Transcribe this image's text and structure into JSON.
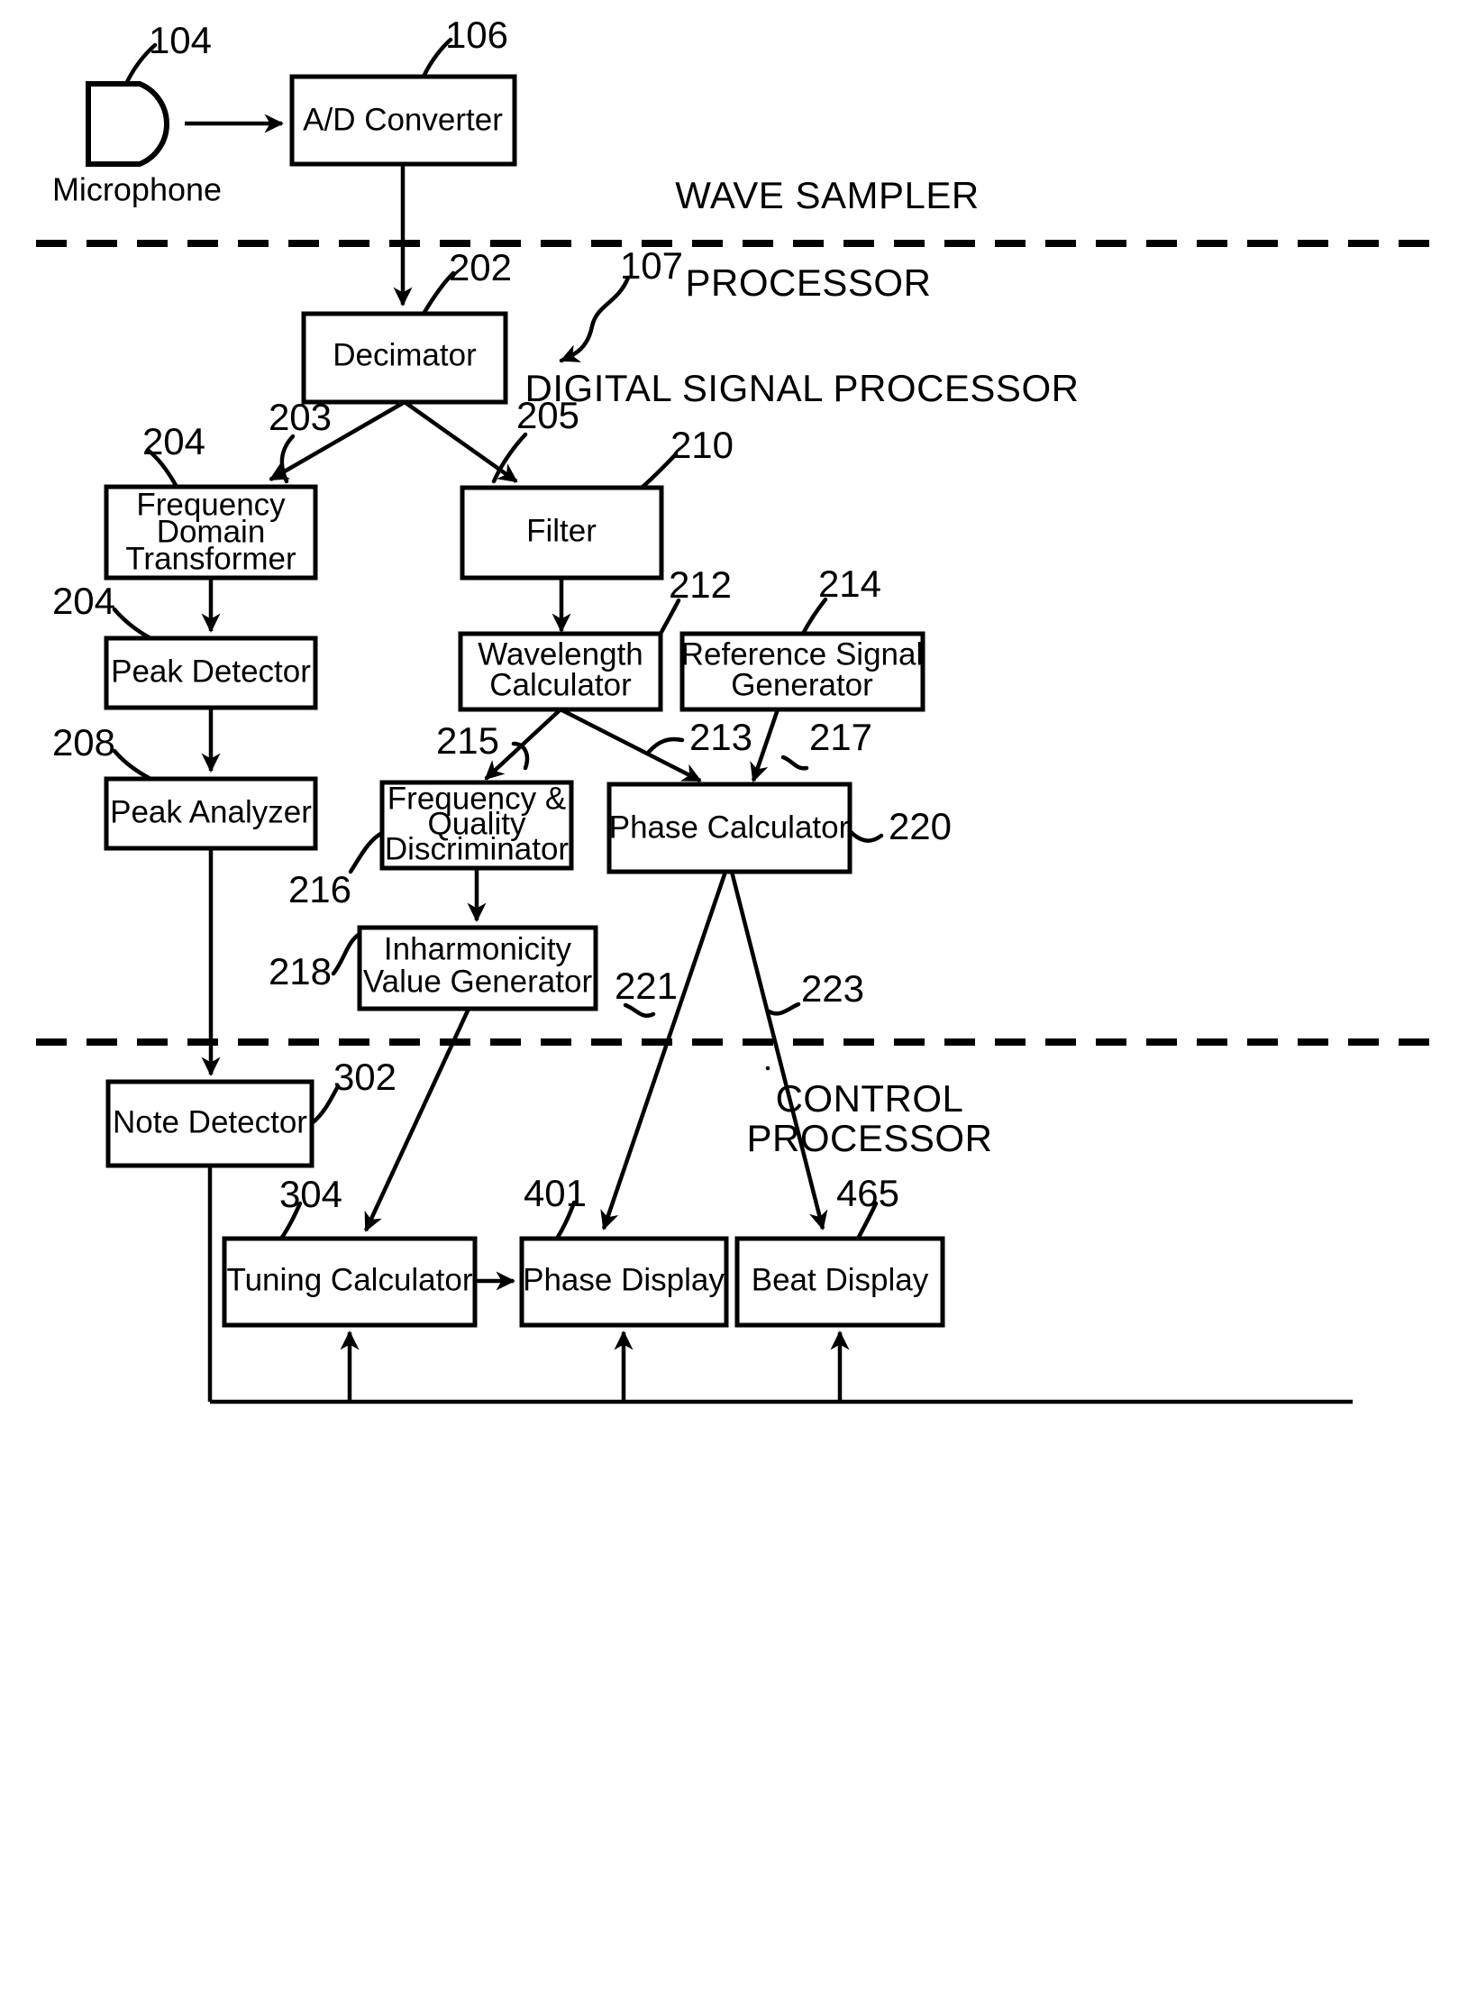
{
  "figure": {
    "type": "patent-block-diagram",
    "title": "Piano tuner signal processing block diagram"
  },
  "blocks": [
    {
      "id": "microphone",
      "label": "Microphone",
      "ref": "104",
      "shape": "d-shape"
    },
    {
      "id": "ad_converter",
      "label": "A/D Converter",
      "ref": "106",
      "shape": "rect"
    },
    {
      "id": "decimator",
      "label": "Decimator",
      "ref": "202",
      "shape": "rect"
    },
    {
      "id": "freq_domain_transformer",
      "label": "Frequency\nDomain\nTransformer",
      "ref": "204",
      "shape": "rect"
    },
    {
      "id": "peak_detector",
      "label": "Peak Detector",
      "ref": "204",
      "shape": "rect"
    },
    {
      "id": "peak_analyzer",
      "label": "Peak Analyzer",
      "ref": "208",
      "shape": "rect"
    },
    {
      "id": "filter",
      "label": "Filter",
      "ref": "210",
      "shape": "rect"
    },
    {
      "id": "wavelength_calculator",
      "label": "Wavelength\nCalculator",
      "ref": "212",
      "shape": "rect"
    },
    {
      "id": "reference_signal_generator",
      "label": "Reference Signal\nGenerator",
      "ref": "214",
      "shape": "rect"
    },
    {
      "id": "freq_quality_discriminator",
      "label": "Frequency &\nQuality\nDiscriminator",
      "ref": "216",
      "shape": "rect"
    },
    {
      "id": "phase_calculator",
      "label": "Phase Calculator",
      "ref": "220",
      "shape": "rect"
    },
    {
      "id": "inharmonicity_value_generator",
      "label": "Inharmonicity\nValue Generator",
      "ref": "218",
      "shape": "rect"
    },
    {
      "id": "note_detector",
      "label": "Note Detector",
      "ref": "302",
      "shape": "rect"
    },
    {
      "id": "tuning_calculator",
      "label": "Tuning Calculator",
      "ref": "304",
      "shape": "rect"
    },
    {
      "id": "phase_display",
      "label": "Phase Display",
      "ref": "401",
      "shape": "rect"
    },
    {
      "id": "beat_display",
      "label": "Beat Display",
      "ref": "465",
      "shape": "rect"
    }
  ],
  "block_labels": {
    "microphone": "Microphone",
    "ad_converter": "A/D Converter",
    "decimator": "Decimator",
    "fdt_line1": "Frequency",
    "fdt_line2": "Domain",
    "fdt_line3": "Transformer",
    "peak_detector": "Peak Detector",
    "peak_analyzer": "Peak Analyzer",
    "filter": "Filter",
    "wavelength_line1": "Wavelength",
    "wavelength_line2": "Calculator",
    "refsig_line1": "Reference Signal",
    "refsig_line2": "Generator",
    "fqd_line1": "Frequency &",
    "fqd_line2": "Quality",
    "fqd_line3": "Discriminator",
    "phase_calculator": "Phase Calculator",
    "inharm_line1": "Inharmonicity",
    "inharm_line2": "Value Generator",
    "note_detector": "Note Detector",
    "tuning_calculator": "Tuning Calculator",
    "phase_display": "Phase Display",
    "beat_display": "Beat Display"
  },
  "reference_numerals": {
    "n104": "104",
    "n106": "106",
    "n107": "107",
    "n202": "202",
    "n203": "203",
    "n204a": "204",
    "n204b": "204",
    "n205": "205",
    "n208": "208",
    "n210": "210",
    "n212": "212",
    "n213": "213",
    "n214": "214",
    "n215": "215",
    "n216": "216",
    "n217": "217",
    "n218": "218",
    "n220": "220",
    "n221": "221",
    "n223": "223",
    "n302": "302",
    "n304": "304",
    "n401": "401",
    "n465": "465"
  },
  "section_labels": {
    "wave_sampler": "WAVE SAMPLER",
    "processor": "PROCESSOR",
    "digital_signal_processor": "DIGITAL SIGNAL PROCESSOR",
    "control_processor_line1": "CONTROL",
    "control_processor_line2": "PROCESSOR"
  },
  "colors": {
    "ink": "#000000",
    "paper": "#ffffff"
  }
}
